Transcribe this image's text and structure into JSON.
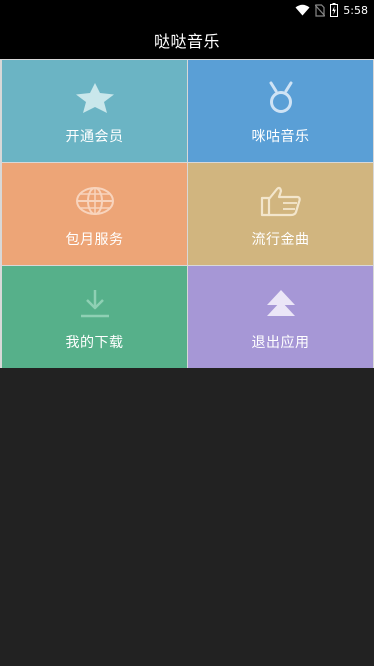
{
  "status_bar": {
    "time": "5:58",
    "icons": [
      "wifi-icon",
      "no-sim-icon",
      "battery-icon"
    ]
  },
  "header": {
    "title": "哒哒音乐"
  },
  "menu": {
    "tiles": [
      {
        "label": "开通会员",
        "icon": "star-icon",
        "color": "#6bb4c4"
      },
      {
        "label": "咪咕音乐",
        "icon": "medal-icon",
        "color": "#5a9fd6"
      },
      {
        "label": "包月服务",
        "icon": "globe-icon",
        "color": "#eda577"
      },
      {
        "label": "流行金曲",
        "icon": "thumbs-up-icon",
        "color": "#d1b57f"
      },
      {
        "label": "我的下载",
        "icon": "download-icon",
        "color": "#56b08a"
      },
      {
        "label": "退出应用",
        "icon": "up-arrow-icon",
        "color": "#a697d6"
      }
    ]
  }
}
